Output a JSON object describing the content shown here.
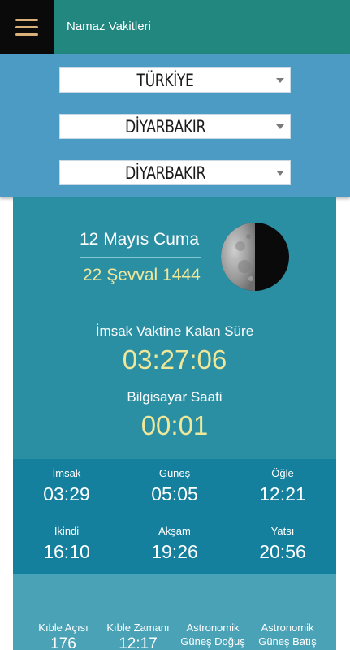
{
  "appbar": {
    "title": "Namaz Vakitleri",
    "menu_icon": "hamburger-menu-icon",
    "color": "#21877f"
  },
  "location": {
    "country": "TÜRKİYE",
    "city": "DİYARBAKIR",
    "district": "DİYARBAKIR"
  },
  "dates": {
    "gregorian": "12 Mayıs Cuma",
    "hijri": "22 Şevval 1444",
    "moon_icon": "half-moon-icon"
  },
  "countdown": {
    "label": "İmsak Vaktine Kalan Süre",
    "value": "03:27:06",
    "clock_label": "Bilgisayar Saati",
    "clock_value": "00:01"
  },
  "times": [
    {
      "name": "İmsak",
      "time": "03:29"
    },
    {
      "name": "Güneş",
      "time": "05:05"
    },
    {
      "name": "Öğle",
      "time": "12:21"
    },
    {
      "name": "İkindi",
      "time": "16:10"
    },
    {
      "name": "Akşam",
      "time": "19:26"
    },
    {
      "name": "Yatsı",
      "time": "20:56"
    }
  ],
  "extras": [
    {
      "label": "Kıble Açısı",
      "value": "176"
    },
    {
      "label": "Kıble Zamanı",
      "value": "12:17"
    },
    {
      "label": "Astronomik Güneş Doğuş",
      "value": ""
    },
    {
      "label": "Astronomik Güneş Batış",
      "value": ""
    }
  ],
  "colors": {
    "accent_yellow": "#efe79a",
    "panel_blue": "#4b9bc4",
    "card_teal": "#2b8fa4",
    "times_bg": "#14809d"
  }
}
